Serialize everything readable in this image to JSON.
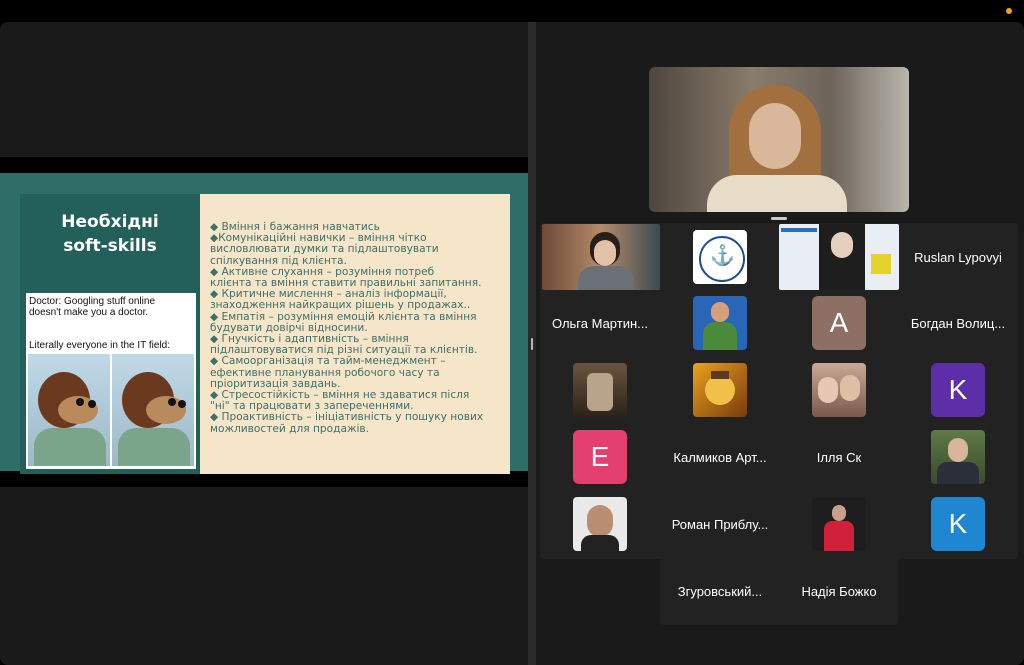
{
  "slide": {
    "title_line1": "Необхідні",
    "title_line2": "soft-skills",
    "meme_caption_line1": "Doctor: Googling stuff online",
    "meme_caption_line2": "doesn't make you a doctor.",
    "meme_caption_line3": "Literally everyone in the IT field:",
    "bullets": [
      "◆ Вміння і бажання навчатись",
      "◆Комунікаційні навички – вміння чітко",
      "висловлювати думки та підлаштовувати",
      "спілкування під клієнта.",
      "◆ Активне слухання – розуміння потреб",
      "клієнта та вміння ставити правильні запитання.",
      "◆ Критичне мислення – аналіз інформації,",
      "знаходження найкращих рішень у продажах..",
      "◆ Емпатія – розуміння емоцій клієнта та вміння",
      "будувати довірчі відносини.",
      "◆ Гнучкість і адаптивність – вміння",
      "підлаштовуватися під різні ситуації та клієнтів.",
      "◆ Самоорганізація та тайм-менеджмент –",
      "ефективне планування робочого часу та",
      "пріоритизація завдань.",
      "◆ Стресостійкість – вміння не здаватися після",
      "\"ні\" та працювати з запереченнями.",
      "◆ Проактивність – ініціативність у пошуку нових",
      "можливостей для продажів."
    ]
  },
  "participants": {
    "ruslan": "Ruslan Lypovyi",
    "olga": "Ольга Мартин...",
    "bohdan": "Богдан Волиц...",
    "kalmykov": "Калмиков Арт...",
    "illia": "Ілля Ск",
    "roman": "Роман Приблу...",
    "zghurovskyi": "Згуровський...",
    "nadiia": "Надія Божко",
    "letter_a": "A",
    "letter_k1": "K",
    "letter_e": "E",
    "letter_k2": "K"
  },
  "colors": {
    "slide_bg": "#2d6e66",
    "slide_card": "#f5e6c9",
    "bullet_text": "#3e6f68",
    "avatar_a": "#8e6f63",
    "avatar_k1": "#5c2fa8",
    "avatar_e": "#e33f70",
    "avatar_k2": "#1f86d1",
    "window_bg": "#1a1a1a"
  },
  "logos": {
    "school_logo_text": "ХТК ОДЕСЬКИЙ МОРСЬКИЙ",
    "poster_text": "ALEXANDRA STAVARNAYA"
  }
}
